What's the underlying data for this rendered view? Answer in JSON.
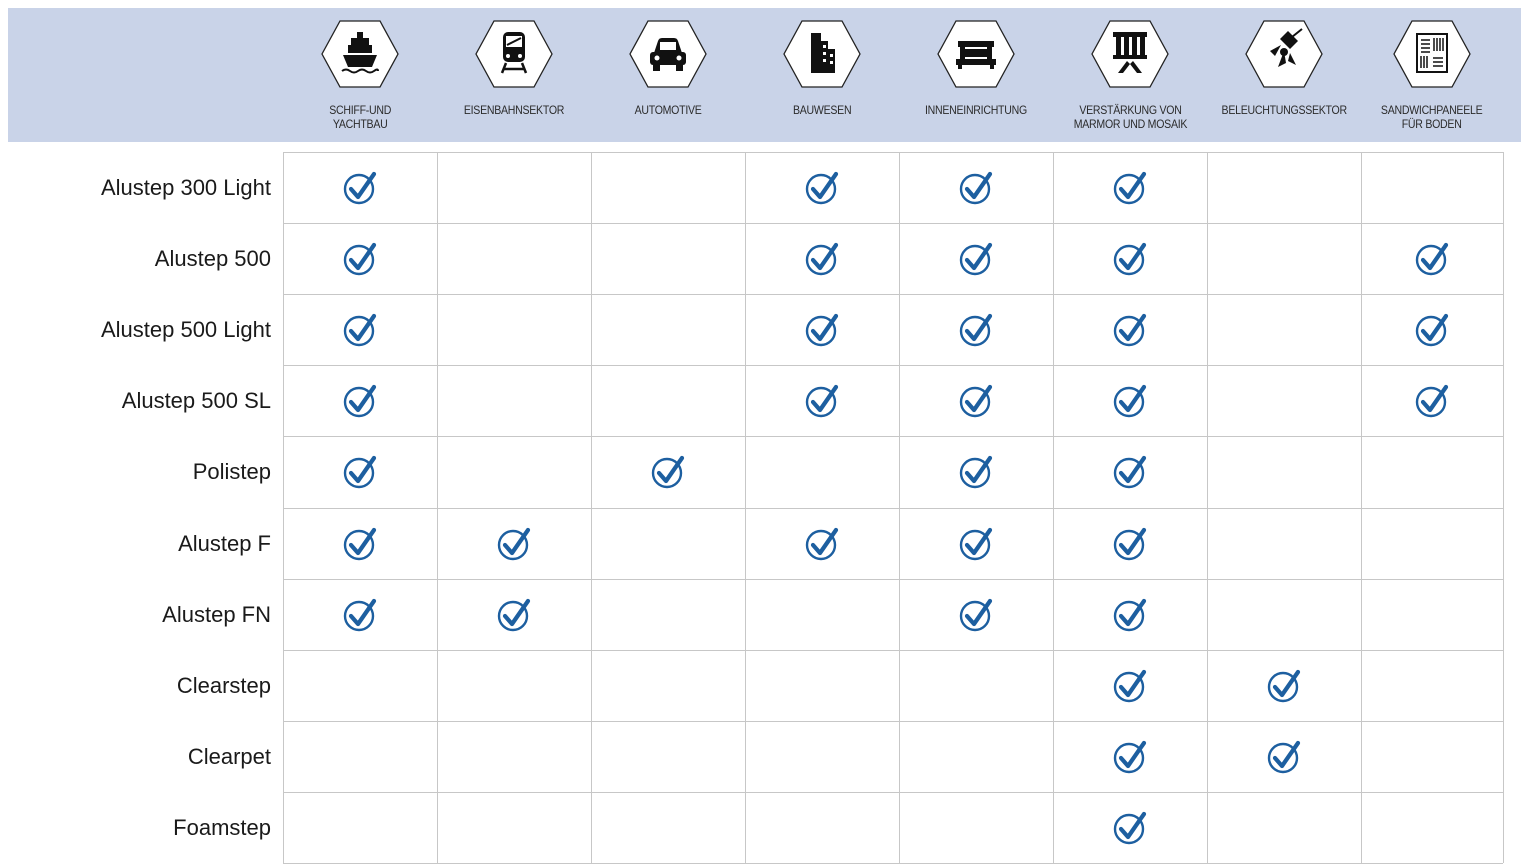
{
  "colors": {
    "header_band": "#c9d3e8",
    "check": "#1d5fa0",
    "grid_line": "#c7c7c7"
  },
  "sectors": [
    {
      "label": "SCHIFF-UND\nYACHTBAU",
      "icon": "ship-icon"
    },
    {
      "label": "EISENBAHNSEKTOR",
      "icon": "train-icon"
    },
    {
      "label": "AUTOMOTIVE",
      "icon": "car-icon"
    },
    {
      "label": "BAUWESEN",
      "icon": "building-icon"
    },
    {
      "label": "INNENEINRICHTUNG",
      "icon": "interior-icon"
    },
    {
      "label": "VERSTÄRKUNG VON\nMARMOR UND MOSAIK",
      "icon": "marble-icon"
    },
    {
      "label": "BELEUCHTUNGSSEKTOR",
      "icon": "spotlight-icon"
    },
    {
      "label": "SANDWICHPANEELE\nFÜR BODEN",
      "icon": "panel-icon"
    }
  ],
  "products": [
    {
      "name": "Alustep 300 Light",
      "checks": [
        true,
        false,
        false,
        true,
        true,
        true,
        false,
        false
      ]
    },
    {
      "name": "Alustep 500",
      "checks": [
        true,
        false,
        false,
        true,
        true,
        true,
        false,
        true
      ]
    },
    {
      "name": "Alustep 500 Light",
      "checks": [
        true,
        false,
        false,
        true,
        true,
        true,
        false,
        true
      ]
    },
    {
      "name": "Alustep 500 SL",
      "checks": [
        true,
        false,
        false,
        true,
        true,
        true,
        false,
        true
      ]
    },
    {
      "name": "Polistep",
      "checks": [
        true,
        false,
        true,
        false,
        true,
        true,
        false,
        false
      ]
    },
    {
      "name": "Alustep F",
      "checks": [
        true,
        true,
        false,
        true,
        true,
        true,
        false,
        false
      ]
    },
    {
      "name": "Alustep FN",
      "checks": [
        true,
        true,
        false,
        false,
        true,
        true,
        false,
        false
      ]
    },
    {
      "name": "Clearstep",
      "checks": [
        false,
        false,
        false,
        false,
        false,
        true,
        true,
        false
      ]
    },
    {
      "name": "Clearpet",
      "checks": [
        false,
        false,
        false,
        false,
        false,
        true,
        true,
        false
      ]
    },
    {
      "name": "Foamstep",
      "checks": [
        false,
        false,
        false,
        false,
        false,
        true,
        false,
        false
      ]
    }
  ]
}
